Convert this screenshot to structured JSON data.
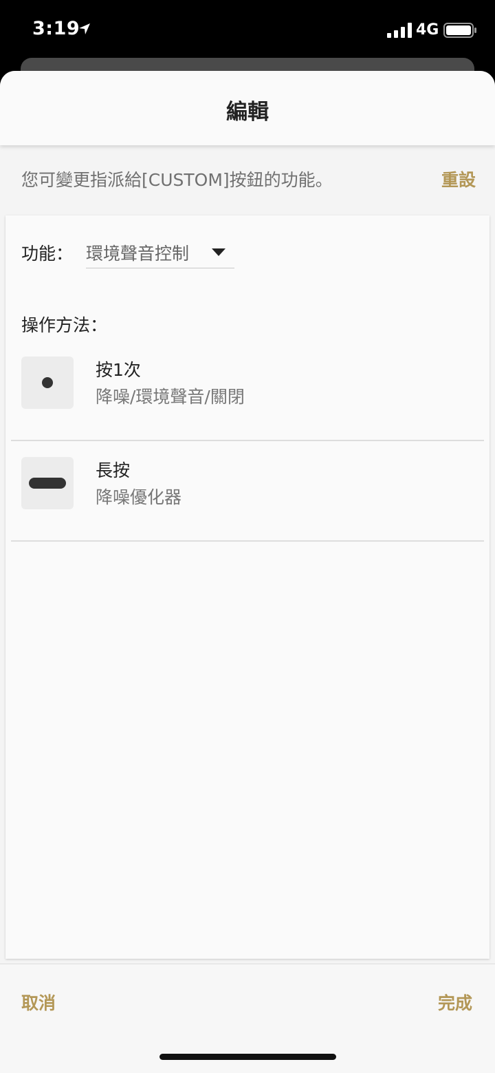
{
  "status_bar": {
    "time": "3:19",
    "network": "4G",
    "icons": [
      "location-arrow-icon",
      "cellular-signal-icon",
      "battery-icon"
    ]
  },
  "header": {
    "title": "編輯"
  },
  "description": {
    "text": "您可變更指派給[CUSTOM]按鈕的功能。",
    "reset_label": "重設"
  },
  "function": {
    "label": "功能：",
    "selected_value": "環境聲音控制"
  },
  "operations": {
    "label": "操作方法：",
    "items": [
      {
        "icon": "single-press-dot-icon",
        "title": "按1次",
        "value": "降噪/環境聲音/關閉"
      },
      {
        "icon": "long-press-bar-icon",
        "title": "長按",
        "value": "降噪優化器"
      }
    ]
  },
  "footer": {
    "cancel_label": "取消",
    "done_label": "完成"
  },
  "colors": {
    "accent": "#b39756",
    "background": "#f4f4f4",
    "text_primary": "#222222",
    "text_secondary": "#777777"
  }
}
